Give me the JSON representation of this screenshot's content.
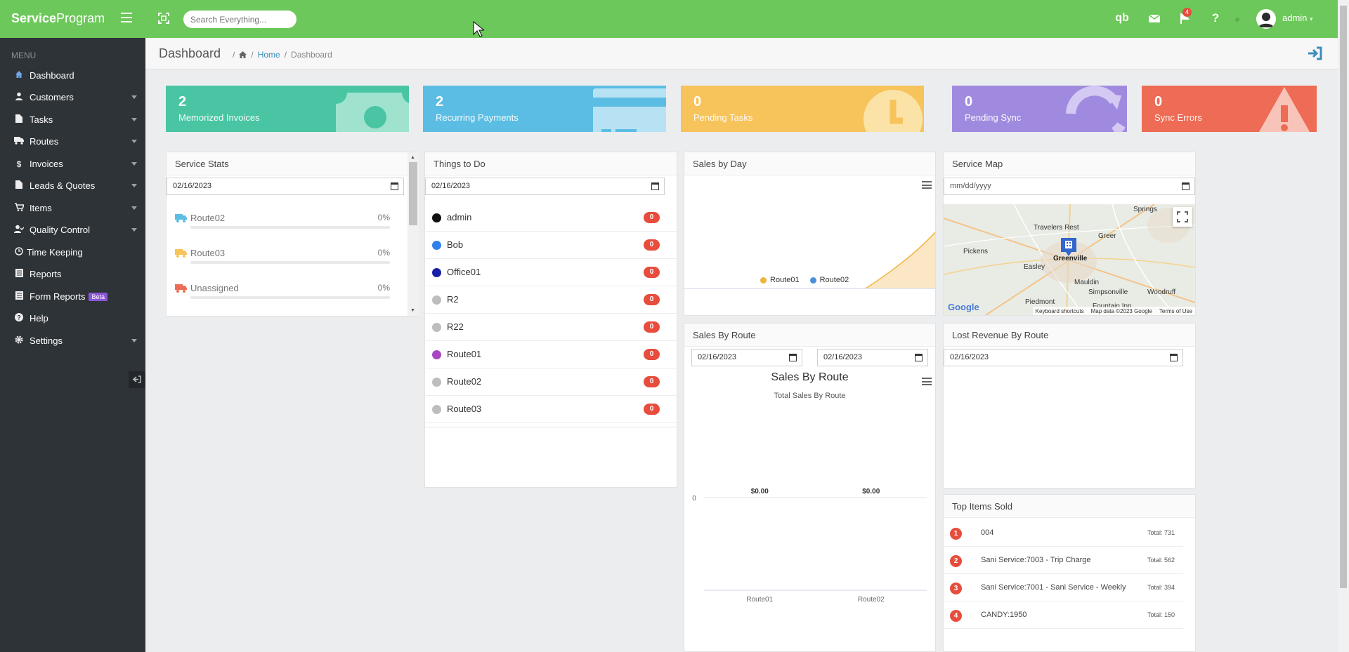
{
  "app": {
    "brand_bold": "Service",
    "brand_rest": "Program",
    "search_placeholder": "Search Everything...",
    "notifications_count": "4",
    "user": "admin"
  },
  "sidebar": {
    "menu_label": "MENU",
    "items": [
      {
        "label": "Dashboard",
        "icon": "home-icon",
        "caret": false,
        "active": true
      },
      {
        "label": "Customers",
        "icon": "user-icon",
        "caret": true
      },
      {
        "label": "Tasks",
        "icon": "file-icon",
        "caret": true
      },
      {
        "label": "Routes",
        "icon": "truck-icon",
        "caret": true
      },
      {
        "label": "Invoices",
        "icon": "dollar-icon",
        "caret": true
      },
      {
        "label": "Leads & Quotes",
        "icon": "file-icon",
        "caret": true
      },
      {
        "label": "Items",
        "icon": "cart-icon",
        "caret": true
      },
      {
        "label": "Quality Control",
        "icon": "user-check-icon",
        "caret": true
      },
      {
        "label": "Time Keeping",
        "icon": "clock-icon",
        "caret": false
      },
      {
        "label": "Reports",
        "icon": "list-icon",
        "caret": false
      },
      {
        "label": "Form Reports",
        "icon": "list-icon",
        "caret": false,
        "badge": "Beta"
      },
      {
        "label": "Help",
        "icon": "question-circle-icon",
        "caret": false
      },
      {
        "label": "Settings",
        "icon": "gear-icon",
        "caret": true
      }
    ]
  },
  "header": {
    "title": "Dashboard",
    "breadcrumb_home": "Home",
    "breadcrumb_current": "Dashboard"
  },
  "tiles": [
    {
      "value": "2",
      "caption": "Memorized Invoices",
      "color": "#49c5a4"
    },
    {
      "value": "2",
      "caption": "Recurring Payments",
      "color": "#5bbde3"
    },
    {
      "value": "0",
      "caption": "Pending Tasks",
      "color": "#f7c35b"
    },
    {
      "value": "0",
      "caption": "Pending Sync",
      "color": "#a08ae0"
    },
    {
      "value": "0",
      "caption": "Sync Errors",
      "color": "#ee6b55"
    }
  ],
  "service_stats": {
    "title": "Service Stats",
    "date": "02/16/2023",
    "routes": [
      {
        "name": "Route02",
        "pct": "0%",
        "truck_color": "#5bbde3",
        "progress": 0
      },
      {
        "name": "Route03",
        "pct": "0%",
        "truck_color": "#f7c35b",
        "progress": 0
      },
      {
        "name": "Unassigned",
        "pct": "0%",
        "truck_color": "#ee6b55",
        "progress": 0
      }
    ]
  },
  "things_to_do": {
    "title": "Things to Do",
    "date": "02/16/2023",
    "rows": [
      {
        "name": "admin",
        "count": "0",
        "color": "#111111"
      },
      {
        "name": "Bob",
        "count": "0",
        "color": "#2f80ed"
      },
      {
        "name": "Office01",
        "count": "0",
        "color": "#1a1fa8"
      },
      {
        "name": "R2",
        "count": "0",
        "color": "#bdbdbd"
      },
      {
        "name": "R22",
        "count": "0",
        "color": "#bdbdbd"
      },
      {
        "name": "Route01",
        "count": "0",
        "color": "#a845c2"
      },
      {
        "name": "Route02",
        "count": "0",
        "color": "#bdbdbd"
      },
      {
        "name": "Route03",
        "count": "0",
        "color": "#bdbdbd"
      }
    ]
  },
  "sales_by_day": {
    "title": "Sales by Day",
    "legend": [
      {
        "name": "Route01",
        "color": "#f0b43a"
      },
      {
        "name": "Route02",
        "color": "#4a90d9"
      }
    ]
  },
  "service_map": {
    "title": "Service Map",
    "date_placeholder": "mm/dd/yyyy",
    "labels": {
      "springs": "Springs",
      "travelers_rest": "Travelers Rest",
      "greer": "Greer",
      "pickens": "Pickens",
      "easley": "Easley",
      "greenville": "Greenville",
      "mauldin": "Mauldin",
      "simpsonville": "Simpsonville",
      "woodruff": "Woodruff",
      "piedmont": "Piedmont",
      "fountain_inn": "Fountain Inn",
      "google": "Google",
      "shortcuts": "Keyboard shortcuts",
      "mapdata": "Map data ©2023 Google",
      "terms": "Terms of Use"
    }
  },
  "sales_by_route": {
    "title": "Sales By Route",
    "date_from": "02/16/2023",
    "date_to": "02/16/2023",
    "chart_title": "Sales By Route",
    "chart_subtitle": "Total Sales By Route",
    "y_tick": "0",
    "chart_data": {
      "type": "bar",
      "title": "Sales By Route",
      "subtitle": "Total Sales By Route",
      "categories": [
        "Route01",
        "Route02"
      ],
      "values": [
        0,
        0
      ],
      "data_labels": [
        "$0.00",
        "$0.00"
      ],
      "y_ticks": [
        "0"
      ]
    }
  },
  "lost_revenue": {
    "title": "Lost Revenue By Route",
    "date": "02/16/2023"
  },
  "top_items": {
    "title": "Top Items Sold",
    "items": [
      {
        "rank": "1",
        "name": "004",
        "total": "Total: 731"
      },
      {
        "rank": "2",
        "name": "Sani Service:7003 - Trip Charge",
        "total": "Total: 562"
      },
      {
        "rank": "3",
        "name": "Sani Service:7001 - Sani Service - Weekly",
        "total": "Total: 394"
      },
      {
        "rank": "4",
        "name": "CANDY:1950",
        "total": "Total: 150"
      }
    ]
  }
}
